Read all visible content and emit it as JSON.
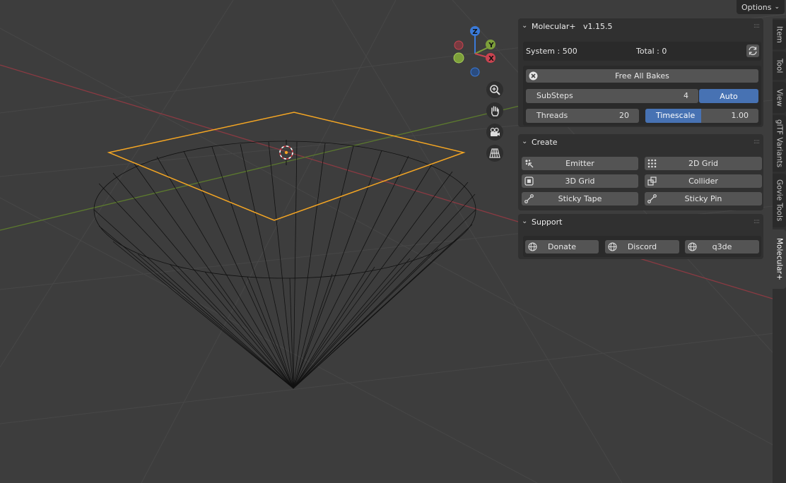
{
  "header": {
    "options_label": "Options"
  },
  "sidebar_tabs": [
    "Item",
    "Tool",
    "View",
    "glTF Variants",
    "Govie Tools",
    "Molecular+"
  ],
  "gizmo": {
    "z": "Z",
    "y": "Y",
    "x": "X"
  },
  "molecular": {
    "title": "Molecular+",
    "version": "v1.15.5",
    "system_label": "System : 500",
    "total_label": "Total : 0",
    "free_all_bakes": "Free All Bakes",
    "substeps_label": "SubSteps",
    "substeps_value": "4",
    "auto_label": "Auto",
    "threads_label": "Threads",
    "threads_value": "20",
    "timescale_label": "Timescale",
    "timescale_value": "1.00"
  },
  "create": {
    "title": "Create",
    "buttons": [
      "Emitter",
      "2D Grid",
      "3D Grid",
      "Collider",
      "Sticky Tape",
      "Sticky Pin"
    ]
  },
  "support": {
    "title": "Support",
    "buttons": [
      "Donate",
      "Discord",
      "q3de"
    ]
  },
  "colors": {
    "accent": "#4772b3",
    "selection": "#f5a623",
    "x_axis": "#c94350",
    "y_axis": "#7da03a",
    "z_axis": "#3a7ad9"
  }
}
